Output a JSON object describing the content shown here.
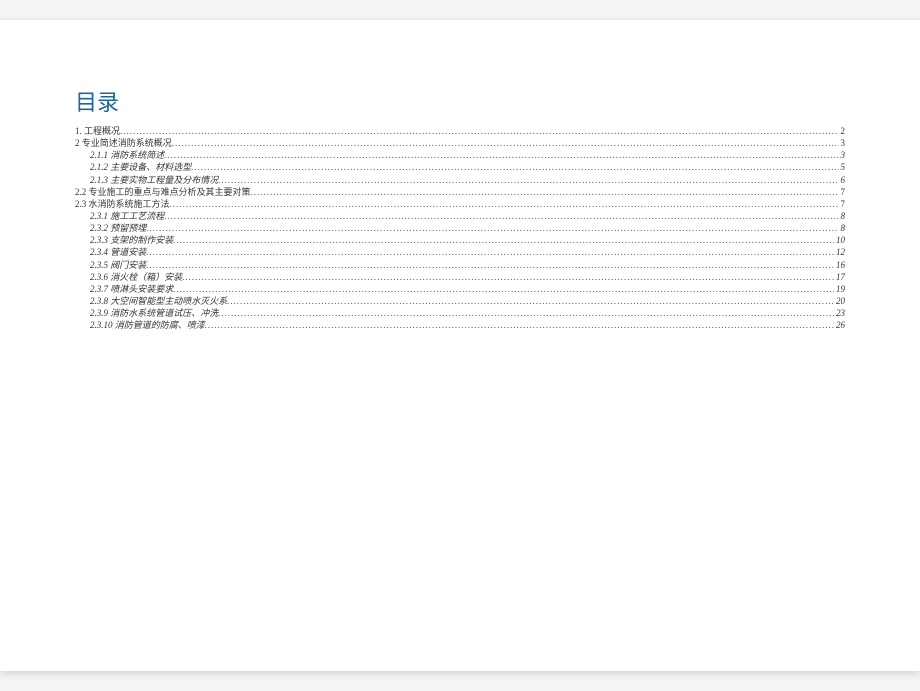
{
  "title": "目录",
  "entries": [
    {
      "level": 1,
      "label": "1.     工程概况",
      "page": "2"
    },
    {
      "level": 1,
      "label": "2 专业简述消防系统概况",
      "page": "3"
    },
    {
      "level": 2,
      "label": "2.1.1   消防系统简述",
      "page": "3"
    },
    {
      "level": 2,
      "label": "2.1.2   主要设备、材料选型",
      "page": "5"
    },
    {
      "level": 2,
      "label": "2.1.3   主要实物工程量及分布情况",
      "page": "6"
    },
    {
      "level": 1,
      "label": "2.2   专业施工的重点与难点分析及其主要对策",
      "page": "7"
    },
    {
      "level": 1,
      "label": "2.3   水消防系统施工方法",
      "page": "7"
    },
    {
      "level": 2,
      "label": "2.3.1   施工工艺流程",
      "page": "8"
    },
    {
      "level": 2,
      "label": "2.3.2   预留预埋",
      "page": "8"
    },
    {
      "level": 2,
      "label": "2.3.3   支架的制作安装",
      "page": "10"
    },
    {
      "level": 2,
      "label": "2.3.4   管道安装",
      "page": "12"
    },
    {
      "level": 2,
      "label": "2.3.5   阀门安装",
      "page": "16"
    },
    {
      "level": 2,
      "label": "2.3.6   消火栓（箱）安装",
      "page": "17"
    },
    {
      "level": 2,
      "label": "2.3.7   喷淋头安装要求",
      "page": "19"
    },
    {
      "level": 2,
      "label": "2.3.8   大空间智能型主动喷水灭火系",
      "page": "20"
    },
    {
      "level": 2,
      "label": "2.3.9   消防水系统管道试压、冲洗",
      "page": "23"
    },
    {
      "level": 2,
      "label": "2.3.10   消防管道的防腐、喷漆",
      "page": "26"
    }
  ]
}
